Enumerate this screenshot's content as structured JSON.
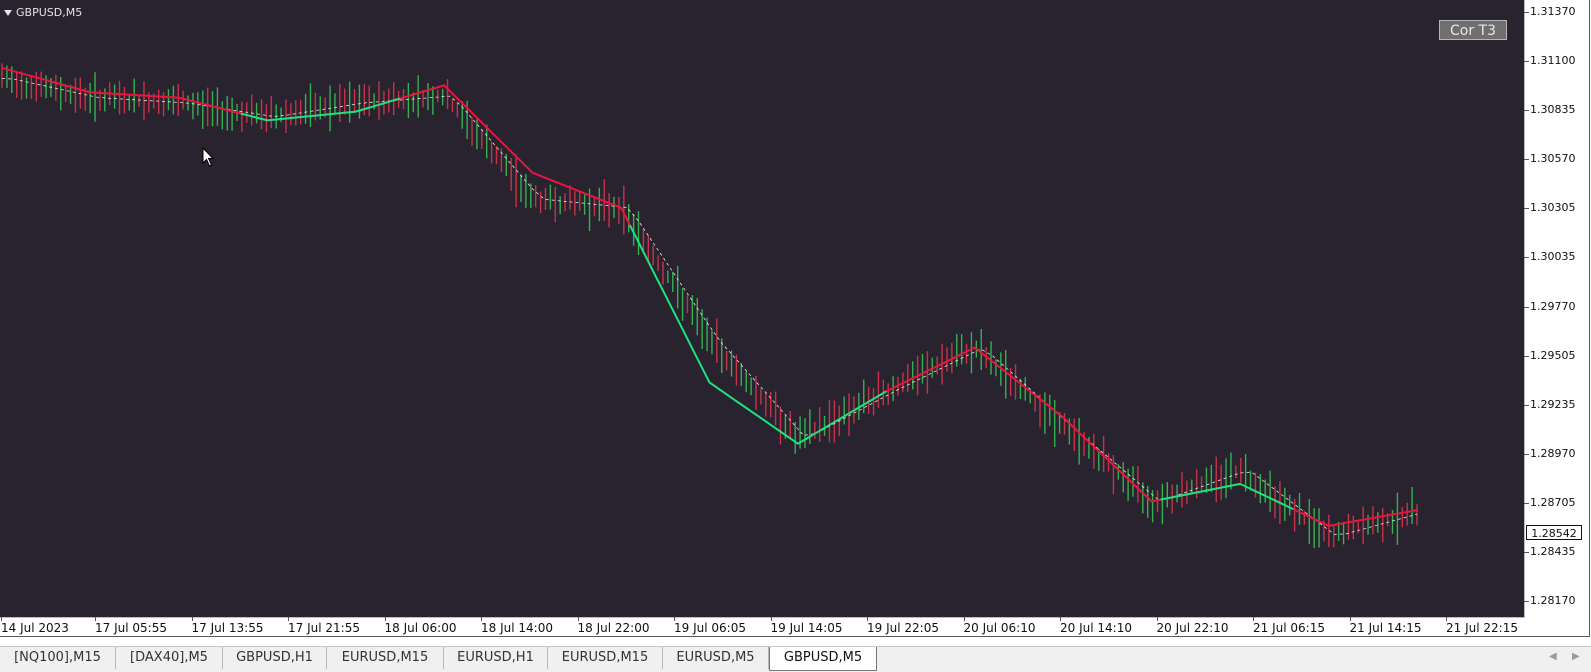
{
  "window": {
    "symbol": "GBPUSD,M5",
    "cor_button": "Cor T3"
  },
  "price_axis": {
    "labels": [
      "1.31370",
      "1.31100",
      "1.30835",
      "1.30570",
      "1.30305",
      "1.30035",
      "1.29770",
      "1.29505",
      "1.29235",
      "1.28970",
      "1.28705",
      "1.28435",
      "1.28170"
    ],
    "current_price": "1.28542"
  },
  "time_axis": {
    "labels": [
      "14 Jul 2023",
      "17 Jul 05:55",
      "17 Jul 13:55",
      "17 Jul 21:55",
      "18 Jul 06:00",
      "18 Jul 14:00",
      "18 Jul 22:00",
      "19 Jul 06:05",
      "19 Jul 14:05",
      "19 Jul 22:05",
      "20 Jul 06:10",
      "20 Jul 14:10",
      "20 Jul 22:10",
      "21 Jul 06:15",
      "21 Jul 14:15",
      "21 Jul 22:15"
    ]
  },
  "tabs": [
    {
      "label": "[NQ100],M15",
      "active": false
    },
    {
      "label": "[DAX40],M5",
      "active": false
    },
    {
      "label": "GBPUSD,H1",
      "active": false
    },
    {
      "label": "EURUSD,M15",
      "active": false
    },
    {
      "label": "EURUSD,H1",
      "active": false
    },
    {
      "label": "EURUSD,M15",
      "active": false
    },
    {
      "label": "EURUSD,M5",
      "active": false
    },
    {
      "label": "GBPUSD,M5",
      "active": true
    }
  ],
  "chart_data": {
    "type": "line",
    "symbol": "GBPUSD,M5",
    "ylim": [
      1.2805,
      1.3142
    ],
    "x": [
      "14 Jul 2023",
      "17 Jul 05:55",
      "17 Jul 13:55",
      "17 Jul 21:55",
      "18 Jul 06:00",
      "18 Jul 14:00",
      "18 Jul 22:00",
      "19 Jul 06:05",
      "19 Jul 14:05",
      "19 Jul 22:05",
      "20 Jul 06:10",
      "20 Jul 14:10",
      "20 Jul 22:10",
      "21 Jul 06:15",
      "21 Jul 14:15",
      "21 Jul 22:15"
    ],
    "price_path": [
      1.3104,
      1.3093,
      1.309,
      1.3082,
      1.309,
      1.3094,
      1.3035,
      1.303,
      1.2955,
      1.2898,
      1.2925,
      1.295,
      1.2905,
      1.2862,
      1.288,
      1.2842,
      1.2856
    ],
    "stop_line": [
      1.311,
      1.3096,
      1.3093,
      1.308,
      1.3085,
      1.31,
      1.305,
      1.303,
      1.293,
      1.2895,
      1.2925,
      1.295,
      1.291,
      1.2862,
      1.2872,
      1.2848,
      1.2857
    ],
    "colors": {
      "background": "#28232f",
      "stop_down": "#e8163c",
      "stop_up": "#1ee37d",
      "candle_up": "#35b050",
      "candle_down": "#c8324a",
      "smoothed_line": "#e6e6e6"
    },
    "grid": false,
    "legend": "none"
  }
}
